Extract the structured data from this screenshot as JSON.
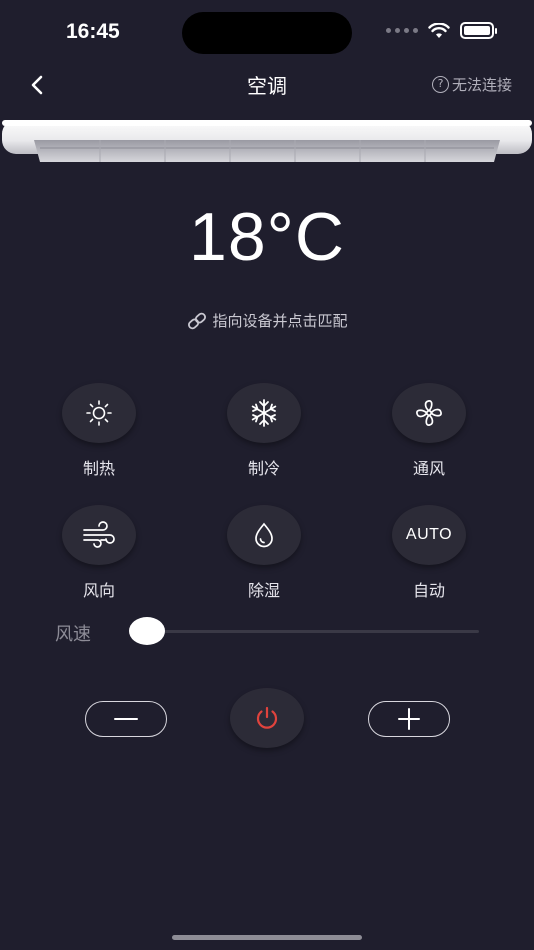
{
  "status_bar": {
    "time": "16:45"
  },
  "nav": {
    "title": "空调",
    "status_icon": "?",
    "status_text": "无法连接"
  },
  "display": {
    "temperature": "18°C",
    "hint": "指向设备并点击匹配"
  },
  "modes": [
    {
      "label": "制热",
      "icon": "sun-icon"
    },
    {
      "label": "制冷",
      "icon": "snowflake-icon"
    },
    {
      "label": "通风",
      "icon": "fan-icon"
    },
    {
      "label": "风向",
      "icon": "wind-icon"
    },
    {
      "label": "除湿",
      "icon": "droplet-icon"
    },
    {
      "label": "自动",
      "icon": "auto-icon",
      "icon_text": "AUTO"
    }
  ],
  "wind_speed": {
    "label": "风速",
    "level": 0
  },
  "colors": {
    "background": "#1f1e2d",
    "power": "#e0433d",
    "button": "#2c2b37"
  }
}
